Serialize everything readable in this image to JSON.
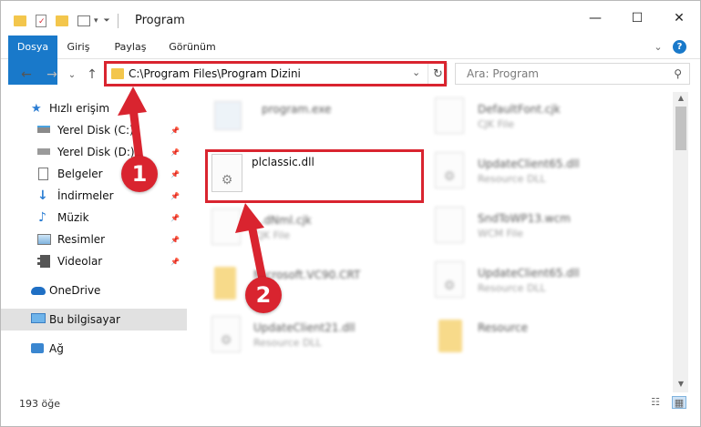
{
  "window": {
    "title": "Program",
    "controls": {
      "minimize": "—",
      "maximize": "☐",
      "close": "✕"
    }
  },
  "ribbon": {
    "tabs": [
      {
        "label": "Dosya"
      },
      {
        "label": "Giriş"
      },
      {
        "label": "Paylaş"
      },
      {
        "label": "Görünüm"
      }
    ],
    "expand": "⌄",
    "help": "?"
  },
  "navigation": {
    "back": "←",
    "forward": "→",
    "recent": "⌄",
    "up": "↑"
  },
  "address": {
    "path": "C:\\Program Files\\Program Dizini",
    "dropdown": "⌄",
    "refresh": "↻"
  },
  "search": {
    "placeholder": "Ara: Program",
    "icon": "⚲"
  },
  "sidebar": {
    "items": [
      {
        "label": "Hızlı erişim",
        "icon": "star-icon",
        "pinned": false
      },
      {
        "label": "Yerel Disk (C:)",
        "icon": "drive-icon",
        "pinned": true
      },
      {
        "label": "Yerel Disk (D:)",
        "icon": "drive-icon",
        "pinned": true
      },
      {
        "label": "Belgeler",
        "icon": "documents-icon",
        "pinned": true
      },
      {
        "label": "İndirmeler",
        "icon": "download-icon",
        "pinned": true
      },
      {
        "label": "Müzik",
        "icon": "music-icon",
        "pinned": true
      },
      {
        "label": "Resimler",
        "icon": "pictures-icon",
        "pinned": true
      },
      {
        "label": "Videolar",
        "icon": "video-icon",
        "pinned": true
      },
      {
        "label": "OneDrive",
        "icon": "cloud-icon",
        "pinned": false
      },
      {
        "label": "Bu bilgisayar",
        "icon": "computer-icon",
        "pinned": false,
        "selected": true
      },
      {
        "label": "Ağ",
        "icon": "network-icon",
        "pinned": false
      }
    ],
    "pin_glyph": "📌"
  },
  "files": [
    {
      "name": "program.exe",
      "type": "",
      "icon": "exe-icon"
    },
    {
      "name": "plclassic.dll",
      "type": "",
      "icon": "dll-icon",
      "highlighted": true
    },
    {
      "name": "...dNml.cjk",
      "type": "CJK File",
      "icon": "doc-icon"
    },
    {
      "name": "Microsoft.VC90.CRT",
      "type": "",
      "icon": "folder-icon"
    },
    {
      "name": "UpdateClient21.dll",
      "type": "Resource DLL",
      "icon": "dll-icon"
    },
    {
      "name": "DefaultFont.cjk",
      "type": "CJK File",
      "icon": "doc-icon"
    },
    {
      "name": "UpdateClient65.dll",
      "type": "Resource DLL",
      "icon": "dll-icon"
    },
    {
      "name": "SndToWP13.wcm",
      "type": "WCM File",
      "icon": "doc-icon"
    },
    {
      "name": "UpdateClient65.dll",
      "type": "Resource DLL",
      "icon": "dll-icon"
    },
    {
      "name": "Resource",
      "type": "",
      "icon": "folder-icon"
    }
  ],
  "status": {
    "count": "193 öğe"
  },
  "callouts": {
    "step1": "1",
    "step2": "2"
  },
  "colors": {
    "accent": "#1979ca",
    "highlight": "#d9242f"
  }
}
